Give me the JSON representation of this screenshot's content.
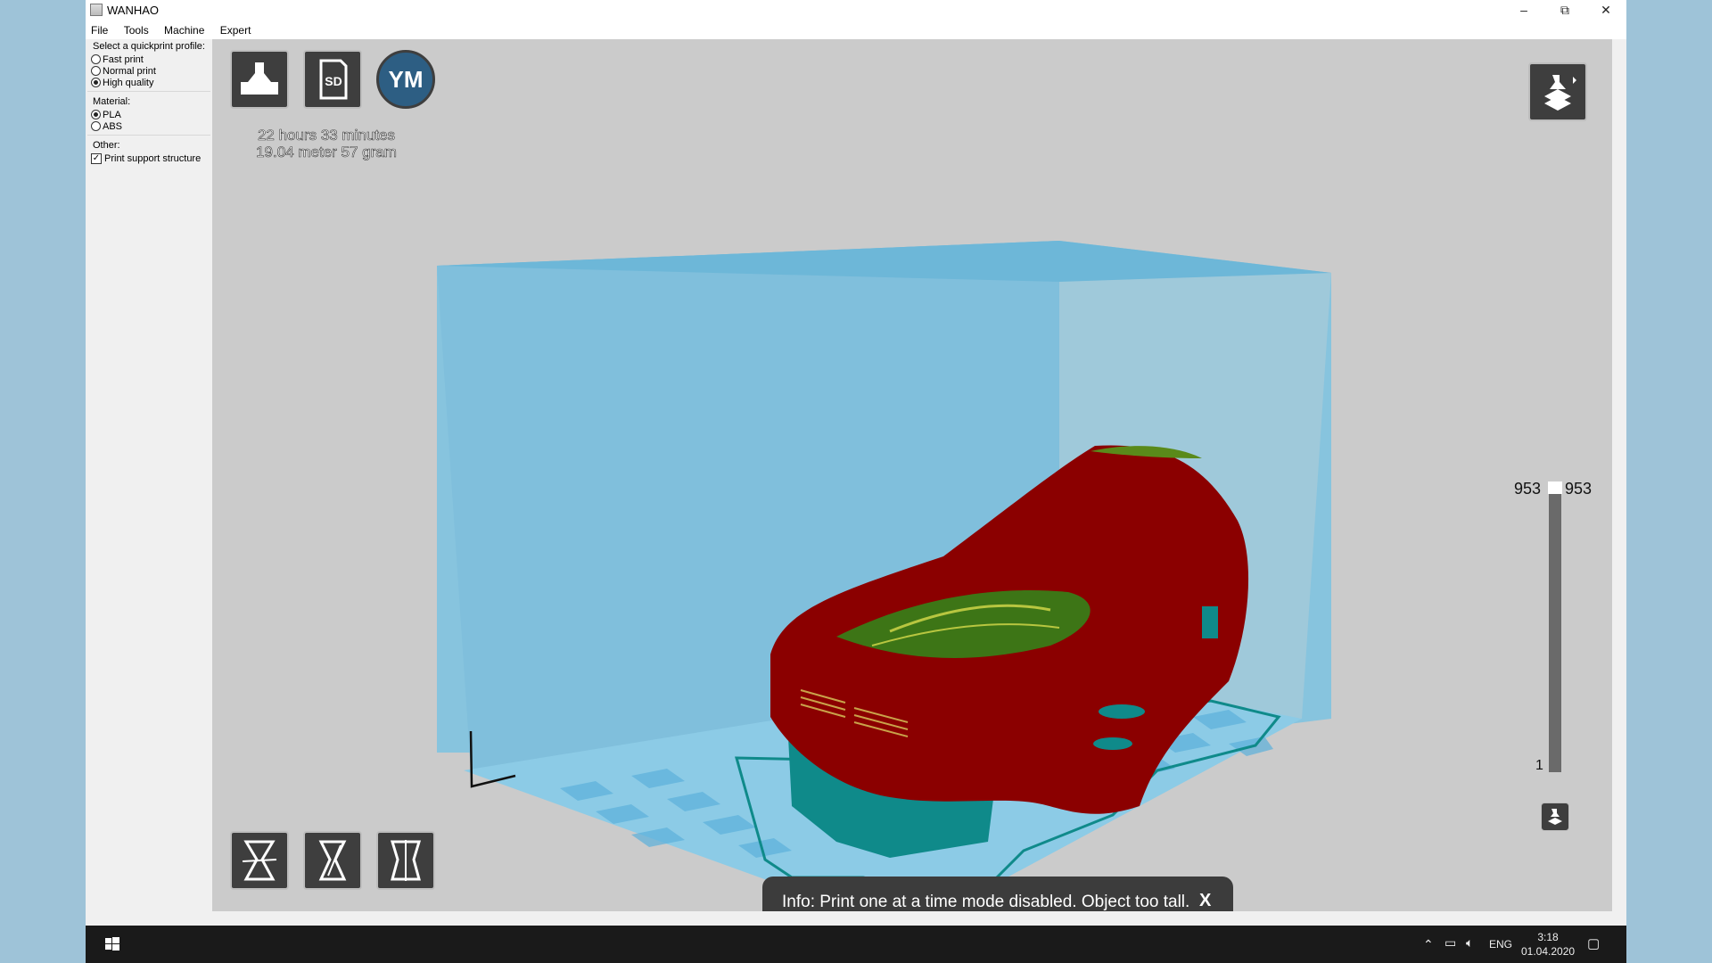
{
  "window": {
    "title": "WANHAO",
    "minimize_glyph": "–",
    "restore_glyph": "⧉",
    "close_glyph": "✕"
  },
  "menu": [
    "File",
    "Tools",
    "Machine",
    "Expert"
  ],
  "sidebar": {
    "profile_header": "Select a quickprint profile:",
    "profiles": [
      {
        "label": "Fast print",
        "selected": false
      },
      {
        "label": "Normal print",
        "selected": false
      },
      {
        "label": "High quality",
        "selected": true
      }
    ],
    "material_header": "Material:",
    "materials": [
      {
        "label": "PLA",
        "selected": true
      },
      {
        "label": "ABS",
        "selected": false
      }
    ],
    "other_header": "Other:",
    "support_label": "Print support structure",
    "support_checked": true
  },
  "toolbar": {
    "load_icon": "load-model-icon",
    "sd_label": "SD",
    "ym_label": "YM"
  },
  "print_info": {
    "time": "22 hours 33 minutes",
    "material": "19.04 meter 57 gram"
  },
  "layers": {
    "top_left": "953",
    "top_right": "953",
    "bottom": "1"
  },
  "info_toast": {
    "text": "Info: Print one at a time mode disabled. Object too tall.",
    "close": "X"
  },
  "colors": {
    "build_volume": "#7fc0dc",
    "model": "#8b0000",
    "support": "#0f8a8a",
    "toolbar_button": "#3e3e3e"
  },
  "taskbar": {
    "language": "ENG",
    "time": "3:18",
    "date": "01.04.2020"
  }
}
